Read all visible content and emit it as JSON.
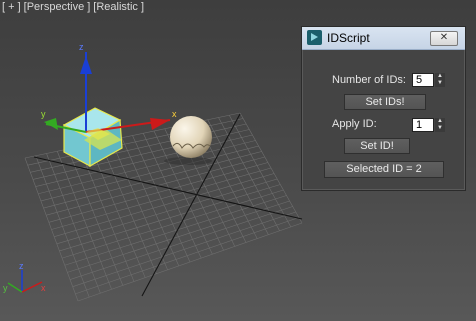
{
  "viewport": {
    "labels": [
      "[ + ]",
      "[Perspective ]",
      "[Realistic ]"
    ],
    "gizmo_axes": {
      "z": "z",
      "x": "x",
      "y": "y"
    },
    "corner_axes": {
      "z": "z",
      "x": "x",
      "y": "y"
    }
  },
  "dialog": {
    "title": "IDScript",
    "close_label": "✕",
    "number_of_ids_label": "Number of IDs:",
    "number_of_ids_value": "5",
    "set_ids_label": "Set IDs!",
    "apply_id_label": "Apply ID:",
    "apply_id_value": "1",
    "set_id_label": "Set ID!",
    "selected_id_label": "Selected ID = 2"
  },
  "colors": {
    "axis_x": "#cc1a1a",
    "axis_y": "#33aa22",
    "axis_z": "#1a3fd6",
    "selection": "#e8e84a",
    "box_fill": "#7fd0d8",
    "sphere": "#e8dcc4"
  }
}
